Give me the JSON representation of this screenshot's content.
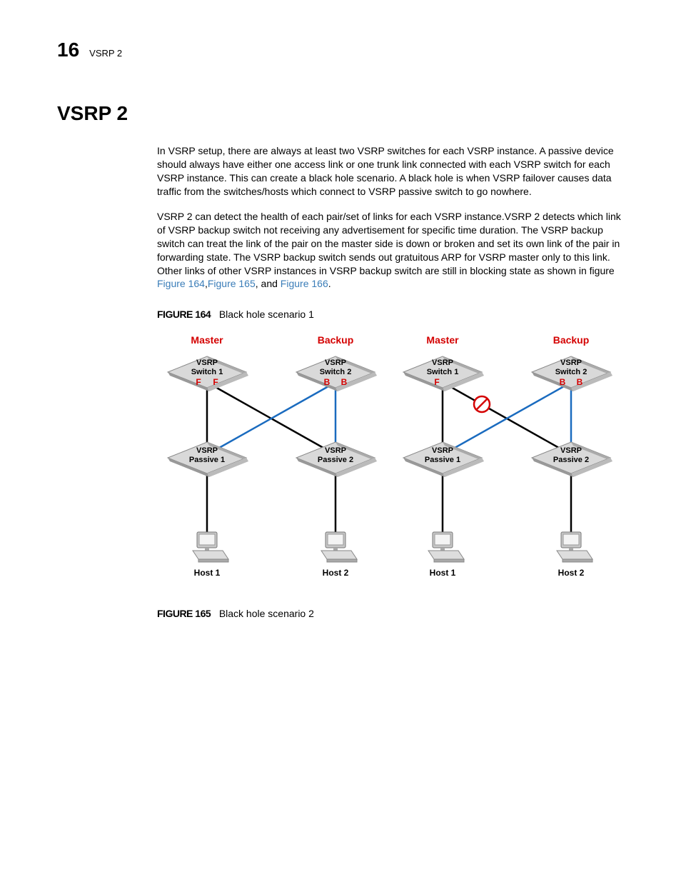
{
  "header": {
    "chapter": "16",
    "section_small": "VSRP 2"
  },
  "section_heading": "VSRP 2",
  "paragraph1": "In VSRP setup, there are always at least two VSRP switches for each VSRP instance. A passive device should always have either one access link or one trunk link connected with each VSRP switch for each VSRP instance. This can create a black hole scenario. A black hole is when VSRP failover causes data traffic from the switches/hosts which connect to VSRP passive switch to go nowhere.",
  "paragraph2_pre": "VSRP 2 can detect the health of each pair/set of links for each VSRP instance.VSRP 2 detects which link of VSRP backup switch not receiving any advertisement for specific time duration. The VSRP backup switch can treat the link of the pair on the master side is down or broken and set its own link of the pair in forwarding state. The VSRP backup switch sends out gratuitous ARP for VSRP master only to this link. Other links of other VSRP instances in VSRP backup switch are still in blocking state as shown in figure ",
  "figure_ref1": "Figure 164",
  "figure_ref2": "Figure 165",
  "figure_ref3": "Figure 166",
  "figure164": {
    "label": "FIGURE 164",
    "caption": "Black hole scenario 1"
  },
  "figure165": {
    "label": "FIGURE 165",
    "caption": "Black hole scenario 2"
  },
  "diagram": {
    "role_master": "Master",
    "role_backup": "Backup",
    "switch1": "VSRP\nSwitch 1",
    "switch2": "VSRP\nSwitch 2",
    "passive1": "VSRP\nPassive 1",
    "passive2": "VSRP\nPassive 2",
    "host1": "Host 1",
    "host2": "Host 2",
    "state_F": "F",
    "state_B": "B"
  }
}
